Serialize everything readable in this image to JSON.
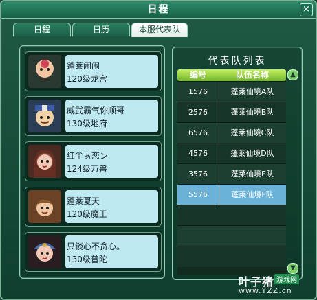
{
  "window": {
    "title": "日程",
    "close_symbol": "×"
  },
  "tabs": [
    {
      "label": "日程",
      "active": false
    },
    {
      "label": "日历",
      "active": false
    },
    {
      "label": "本服代表队",
      "active": true
    }
  ],
  "players": [
    {
      "name": "蓬莱闹闹",
      "detail": "120级龙宫",
      "avatar_icon": "bald-tattooed-character-icon"
    },
    {
      "name": "威武霸气你顺哥",
      "detail": "130级地府",
      "avatar_icon": "headband-character-icon"
    },
    {
      "name": "红尘ぁ恋ン",
      "detail": "124级万兽",
      "avatar_icon": "female-character-icon"
    },
    {
      "name": "蓬莱夏天",
      "detail": "120级魔王",
      "avatar_icon": "brown-haired-character-icon"
    },
    {
      "name": "只谈心不贪心。",
      "detail": "130级普陀",
      "avatar_icon": "female-headdress-character-icon"
    }
  ],
  "team_list": {
    "title": "代表队列表",
    "headers": {
      "id": "编号",
      "team_name": "队伍名称"
    },
    "rows": [
      {
        "id": "1576",
        "team_name": "蓬莱仙境A队"
      },
      {
        "id": "2576",
        "team_name": "蓬莱仙境B队"
      },
      {
        "id": "6576",
        "team_name": "蓬莱仙境C队"
      },
      {
        "id": "4576",
        "team_name": "蓬莱仙境D队"
      },
      {
        "id": "3576",
        "team_name": "蓬莱仙境E队"
      },
      {
        "id": "5576",
        "team_name": "蓬莱仙境F队",
        "selected": true
      }
    ]
  },
  "scrollbar": {
    "up_symbol": "▲",
    "down_symbol": "▼"
  },
  "watermark": {
    "name": "叶子猪",
    "tag": "游戏网",
    "url": "www.YZZ.cn"
  },
  "colors": {
    "window_bg": "#1f5a44",
    "info_box": "#bfe9f0",
    "header_green": "#6fb42d",
    "selected_row": "#6bb2d8"
  }
}
